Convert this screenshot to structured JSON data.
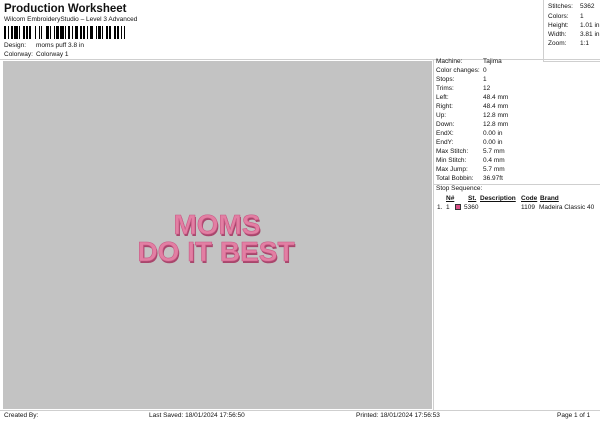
{
  "header": {
    "title": "Production Worksheet",
    "subtitle": "Wilcom EmbroideryStudio – Level 3 Advanced"
  },
  "details": {
    "design_label": "Design:",
    "design_value": "moms puff 3.8 in",
    "colorway_label": "Colorway:",
    "colorway_value": "Colorway 1"
  },
  "summary": {
    "stitches_label": "Stitches:",
    "stitches_value": "5362",
    "colors_label": "Colors:",
    "colors_value": "1",
    "height_label": "Height:",
    "height_value": "1.01 in",
    "width_label": "Width:",
    "width_value": "3.81 in",
    "zoom_label": "Zoom:",
    "zoom_value": "1:1"
  },
  "design": {
    "line1": "MOMS",
    "line2": "DO IT BEST",
    "thread_color": "#e27fa3",
    "shadow_color": "#a8466c",
    "background_color": "#c3c3c3"
  },
  "machine_info": [
    {
      "label": "Machine:",
      "value": "Tajima"
    },
    {
      "label": "Color changes:",
      "value": "0"
    },
    {
      "label": "Stops:",
      "value": "1"
    },
    {
      "label": "Trims:",
      "value": "12"
    },
    {
      "label": "Left:",
      "value": "48.4 mm"
    },
    {
      "label": "Right:",
      "value": "48.4 mm"
    },
    {
      "label": "Up:",
      "value": "12.8 mm"
    },
    {
      "label": "Down:",
      "value": "12.8 mm"
    },
    {
      "label": "EndX:",
      "value": "0.00 in"
    },
    {
      "label": "EndY:",
      "value": "0.00 in"
    },
    {
      "label": "Max Stitch:",
      "value": "5.7 mm"
    },
    {
      "label": "Min Stitch:",
      "value": "0.4 mm"
    },
    {
      "label": "Max Jump:",
      "value": "5.7 mm"
    },
    {
      "label": "Total Bobbin:",
      "value": "36.97ft"
    }
  ],
  "stop_sequence": {
    "title": "Stop Sequence:",
    "headers": {
      "n": "N#",
      "st": "St.",
      "description": "Description",
      "code": "Code",
      "brand": "Brand"
    },
    "rows": [
      {
        "index": "1.",
        "n": "1",
        "swatch_color": "#d94f86",
        "st": "5360",
        "description": "",
        "code": "1109",
        "brand": "Madeira Classic 40"
      }
    ]
  },
  "footer": {
    "created_by": "Created By:",
    "last_saved": "Last Saved: 18/01/2024 17:56:50",
    "printed": "Printed: 18/01/2024 17:56:53",
    "page": "Page 1 of 1"
  }
}
